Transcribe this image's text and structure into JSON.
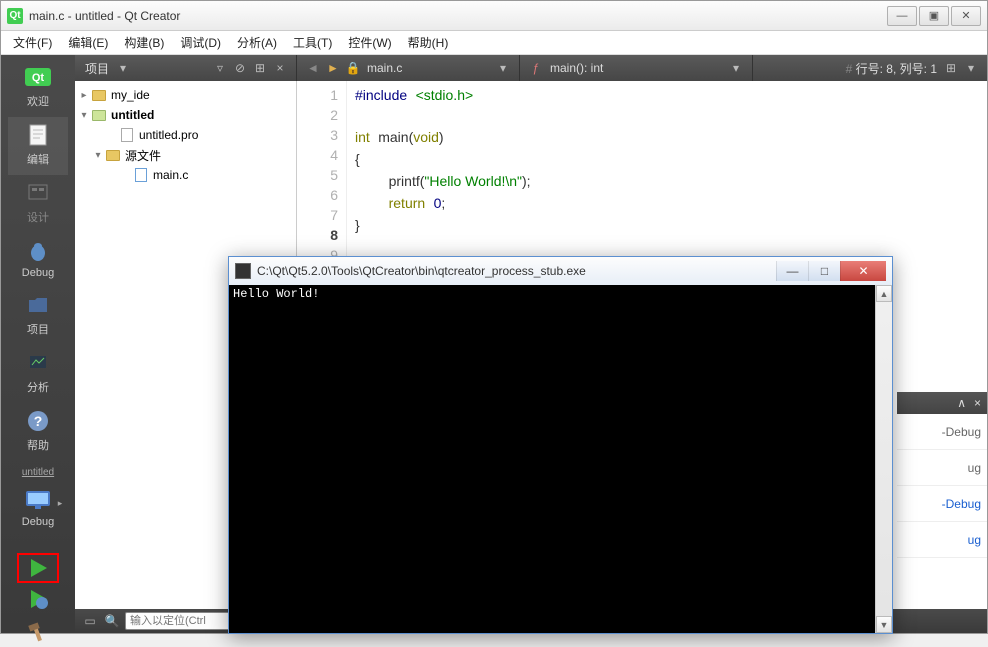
{
  "window": {
    "title": "main.c - untitled - Qt Creator",
    "btn_min": "—",
    "btn_max": "▣",
    "btn_close": "✕"
  },
  "menu": {
    "file": "文件(F)",
    "edit": "编辑(E)",
    "build": "构建(B)",
    "debug": "调试(D)",
    "analyze": "分析(A)",
    "tools": "工具(T)",
    "widgets": "控件(W)",
    "help": "帮助(H)"
  },
  "modebar": {
    "welcome": "欢迎",
    "edit": "编辑",
    "design": "设计",
    "debug": "Debug",
    "projects": "项目",
    "analyze": "分析",
    "help": "帮助",
    "target_project": "untitled",
    "target_kit": "Debug"
  },
  "toolbar": {
    "project_combo": "项目",
    "file_label": "main.c",
    "symbol_label": "main(): int",
    "line_col": "行号: 8, 列号: 1"
  },
  "tree": {
    "root": "my_ide",
    "project": "untitled",
    "pro_file": "untitled.pro",
    "sources_folder": "源文件",
    "main_c": "main.c"
  },
  "editor": {
    "lines_total": 9,
    "current_line": 8,
    "code": {
      "l1_a": "#include",
      "l1_b": "<stdio.h>",
      "l3_a": "int",
      "l3_b": "main",
      "l3_c": "(",
      "l3_d": "void",
      "l3_e": ")",
      "l4": "{",
      "l5_a": "printf",
      "l5_b": "(",
      "l5_c": "\"Hello World!\\n\"",
      "l5_d": ");",
      "l6_a": "return",
      "l6_b": "0",
      "l6_c": ";",
      "l7": "}"
    }
  },
  "statusbar": {
    "search_placeholder": "输入以定位(Ctrl"
  },
  "right_panel": {
    "item1": "-Debug",
    "item2": "ug",
    "item3": "-Debug",
    "item4": "ug"
  },
  "console": {
    "title": "C:\\Qt\\Qt5.2.0\\Tools\\QtCreator\\bin\\qtcreator_process_stub.exe",
    "output": "Hello World!",
    "btn_min": "—",
    "btn_max": "□",
    "btn_close": "✕"
  },
  "chart_data": null
}
